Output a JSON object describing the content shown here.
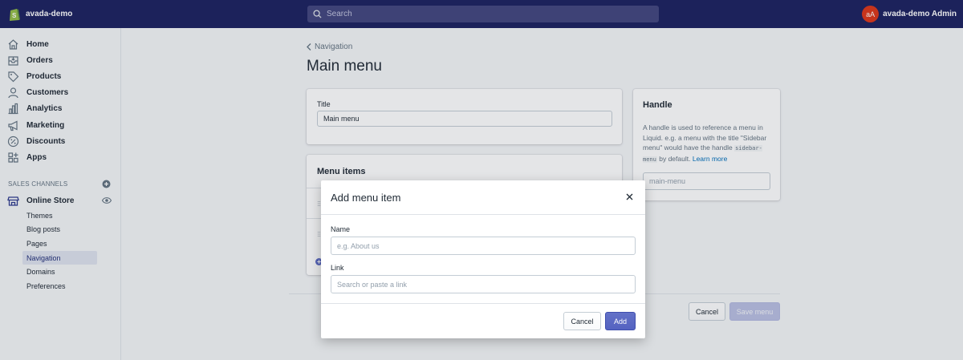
{
  "topbar": {
    "store_name": "avada-demo",
    "search_placeholder": "Search",
    "user_initials": "aA",
    "user_name": "avada-demo Admin"
  },
  "sidebar": {
    "items": [
      {
        "label": "Home",
        "icon": "home-icon"
      },
      {
        "label": "Orders",
        "icon": "orders-icon"
      },
      {
        "label": "Products",
        "icon": "tag-icon"
      },
      {
        "label": "Customers",
        "icon": "person-icon"
      },
      {
        "label": "Analytics",
        "icon": "bar-chart-icon"
      },
      {
        "label": "Marketing",
        "icon": "megaphone-icon"
      },
      {
        "label": "Discounts",
        "icon": "discount-icon"
      },
      {
        "label": "Apps",
        "icon": "apps-icon"
      }
    ],
    "sales_channels_label": "SALES CHANNELS",
    "online_store": "Online Store",
    "sub_items": [
      {
        "label": "Themes",
        "active": false
      },
      {
        "label": "Blog posts",
        "active": false
      },
      {
        "label": "Pages",
        "active": false
      },
      {
        "label": "Navigation",
        "active": true
      },
      {
        "label": "Domains",
        "active": false
      },
      {
        "label": "Preferences",
        "active": false
      }
    ]
  },
  "main": {
    "breadcrumb": "Navigation",
    "title": "Main menu",
    "title_card": {
      "label": "Title",
      "value": "Main menu"
    },
    "menu_items_card": {
      "heading": "Menu items"
    },
    "handle_card": {
      "heading": "Handle",
      "text_1": "A handle is used to reference a menu in Liquid. e.g. a menu with the title \"Sidebar menu\" would have the handle",
      "code": "sidebar-menu",
      "text_2": "by default.",
      "link": "Learn more",
      "input_value": "main-menu"
    },
    "cancel_label": "Cancel",
    "save_label": "Save menu"
  },
  "modal": {
    "title": "Add menu item",
    "name_label": "Name",
    "name_placeholder": "e.g. About us",
    "link_label": "Link",
    "link_placeholder": "Search or paste a link",
    "cancel_label": "Cancel",
    "add_label": "Add"
  },
  "colors": {
    "topbar": "#1c2260",
    "primary": "#5c6ac4",
    "active_nav": "#202e78"
  }
}
